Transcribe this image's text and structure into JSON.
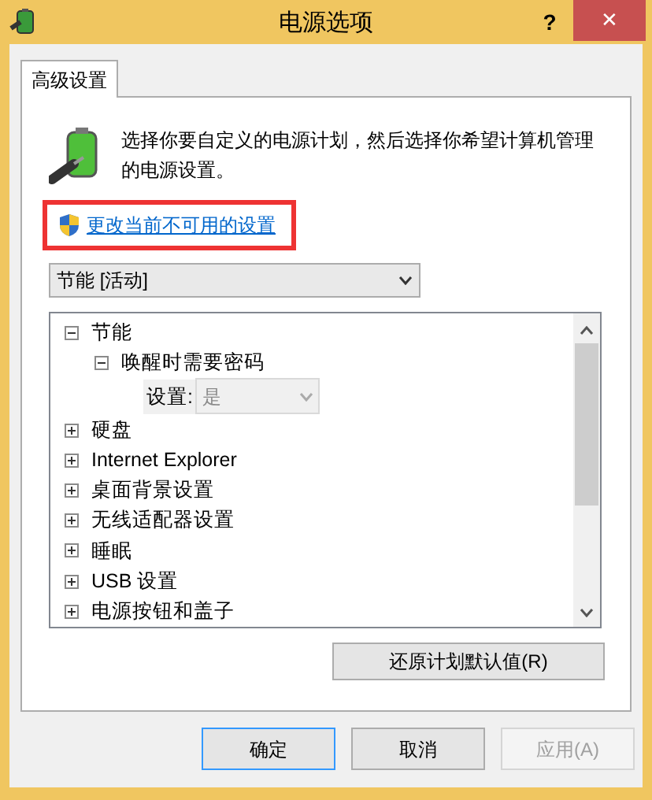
{
  "window": {
    "title": "电源选项",
    "help": "?",
    "close": "✕"
  },
  "tabs": [
    {
      "label": "高级设置",
      "selected": true
    }
  ],
  "description": "选择你要自定义的电源计划，然后选择你希望计算机管理的电源设置。",
  "admin_link": {
    "label": "更改当前不可用的设置",
    "highlighted": true
  },
  "plan_select": {
    "value": "节能 [活动]"
  },
  "tree": [
    {
      "label": "节能",
      "expanded": true,
      "children": [
        {
          "label": "唤醒时需要密码",
          "expanded": true,
          "setting": {
            "label": "设置:",
            "value": "是",
            "disabled": true
          }
        }
      ]
    },
    {
      "label": "硬盘",
      "expanded": false
    },
    {
      "label": "Internet Explorer",
      "expanded": false
    },
    {
      "label": "桌面背景设置",
      "expanded": false
    },
    {
      "label": "无线适配器设置",
      "expanded": false
    },
    {
      "label": "睡眠",
      "expanded": false
    },
    {
      "label": "USB 设置",
      "expanded": false
    },
    {
      "label": "电源按钮和盖子",
      "expanded": false
    }
  ],
  "restore_button": "还原计划默认值(R)",
  "buttons": [
    {
      "label": "确定",
      "default": true,
      "disabled": false
    },
    {
      "label": "取消",
      "default": false,
      "disabled": false
    },
    {
      "label": "应用(A)",
      "default": false,
      "disabled": true
    }
  ]
}
